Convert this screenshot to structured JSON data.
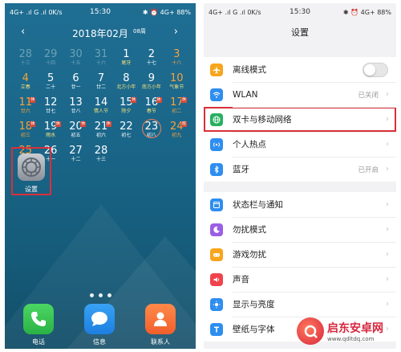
{
  "left": {
    "status": {
      "network": "4G+ .ıl G .ıl 0K/s",
      "time": "15:30",
      "indicators": "✱ ⏰ 4G+ 88%"
    },
    "calendar": {
      "month_title": "2018年02月",
      "week_label": "08周",
      "prev_icon": "‹",
      "next_icon": "›",
      "cells": [
        {
          "d": "28",
          "l": "十三",
          "dim": true
        },
        {
          "d": "29",
          "l": "十四",
          "dim": true
        },
        {
          "d": "30",
          "l": "十五",
          "dim": true
        },
        {
          "d": "31",
          "l": "十六",
          "dim": true
        },
        {
          "d": "1",
          "l": "尾牙",
          "yellow": true
        },
        {
          "d": "2",
          "l": "十七"
        },
        {
          "d": "3",
          "l": "十八",
          "orange": true
        },
        {
          "d": "4",
          "l": "立春",
          "yellow": true,
          "orange": true
        },
        {
          "d": "5",
          "l": "二十"
        },
        {
          "d": "6",
          "l": "廿一"
        },
        {
          "d": "7",
          "l": "廿二"
        },
        {
          "d": "8",
          "l": "北方小年",
          "yellow": true
        },
        {
          "d": "9",
          "l": "南方小年",
          "yellow": true
        },
        {
          "d": "10",
          "l": "气象节",
          "yellow": true,
          "orange": true
        },
        {
          "d": "11",
          "l": "廿六",
          "orange": true,
          "badge": "休"
        },
        {
          "d": "12",
          "l": "廿七"
        },
        {
          "d": "13",
          "l": "廿八"
        },
        {
          "d": "14",
          "l": "情人节",
          "yellow": true
        },
        {
          "d": "15",
          "l": "除夕",
          "yellow": true,
          "badge": "休"
        },
        {
          "d": "16",
          "l": "春节",
          "yellow": true,
          "badge": "休"
        },
        {
          "d": "17",
          "l": "初二",
          "orange": true,
          "badge": "休"
        },
        {
          "d": "18",
          "l": "初三",
          "orange": true,
          "badge": "休"
        },
        {
          "d": "19",
          "l": "雨水",
          "yellow": true,
          "badge": "休"
        },
        {
          "d": "20",
          "l": "初五",
          "badge": "休"
        },
        {
          "d": "21",
          "l": "初六",
          "badge": "休"
        },
        {
          "d": "22",
          "l": "初七"
        },
        {
          "d": "23",
          "l": "初八",
          "today": true
        },
        {
          "d": "24",
          "l": "初九",
          "orange": true,
          "badge": "班"
        },
        {
          "d": "25",
          "l": "初十",
          "orange": true
        },
        {
          "d": "26",
          "l": "十一"
        },
        {
          "d": "27",
          "l": "十二"
        },
        {
          "d": "28",
          "l": "十三"
        }
      ]
    },
    "settings_app": {
      "label": "设置"
    },
    "dock": {
      "phone_label": "电话",
      "messages_label": "信息",
      "contacts_label": "联系人"
    }
  },
  "right": {
    "status": {
      "network": "4G+ .ıl G .ıl 0K/s",
      "time": "15:30",
      "indicators": "✱ ⏰ 4G+ 88%"
    },
    "title": "设置",
    "group1": [
      {
        "id": "airplane",
        "name": "离线模式",
        "type": "toggle",
        "icon_color": "#f7a51c"
      },
      {
        "id": "wlan",
        "name": "WLAN",
        "value": "已关闭",
        "icon_color": "#2e8ef0"
      },
      {
        "id": "dual-sim",
        "name": "双卡与移动网络",
        "icon_color": "#27b060",
        "highlight": true
      },
      {
        "id": "hotspot",
        "name": "个人热点",
        "icon_color": "#2e8ef0"
      },
      {
        "id": "bluetooth",
        "name": "蓝牙",
        "value": "已开启",
        "icon_color": "#2e8ef0"
      }
    ],
    "group2": [
      {
        "id": "statusbar",
        "name": "状态栏与通知",
        "icon_color": "#2e8ef0"
      },
      {
        "id": "dnd",
        "name": "勿扰模式",
        "icon_color": "#9b5de5"
      },
      {
        "id": "game-dnd",
        "name": "游戏勿扰",
        "icon_color": "#f7a51c"
      },
      {
        "id": "sound",
        "name": "声音",
        "icon_color": "#f0444d"
      },
      {
        "id": "display",
        "name": "显示与亮度",
        "icon_color": "#2e8ef0"
      },
      {
        "id": "wallpaper",
        "name": "壁纸与字体",
        "icon_color": "#2e8ef0"
      }
    ]
  },
  "watermark": {
    "cn": "启东安卓网",
    "url": "www.qdltdq.com"
  }
}
